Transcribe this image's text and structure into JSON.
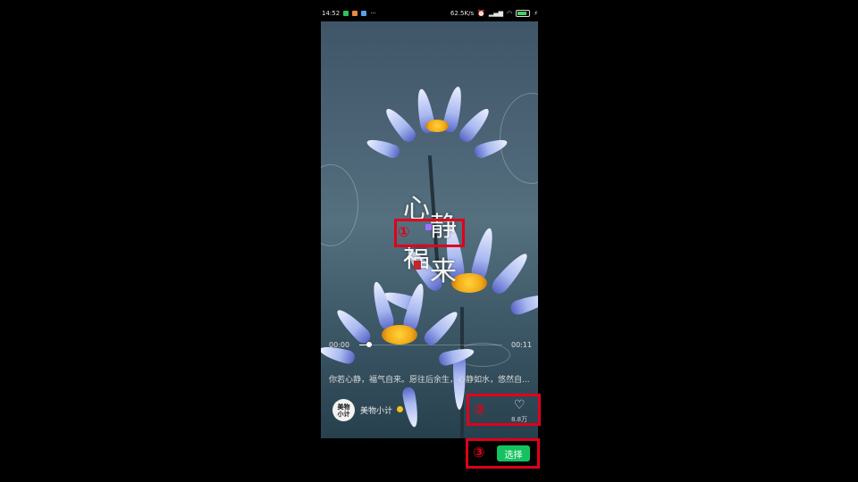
{
  "status_bar": {
    "time": "14:52",
    "more": "···",
    "network_speed": "62.5K/s",
    "battery_level": 0.8
  },
  "video": {
    "title_art": [
      "心",
      "静",
      "福",
      "来"
    ],
    "time_current": "00:00",
    "time_total": "00:11",
    "progress": 0.05,
    "caption": "你若心静，福气自来。愿往后余生，心静如水，悠然自...",
    "author_avatar": "美物\n小计",
    "author_name": "美物小计",
    "likes": "8.8万"
  },
  "annotations": {
    "marker_1": "①",
    "marker_2": "②",
    "marker_3": "③",
    "box_color": "#e0001b"
  },
  "actions": {
    "select_label": "选择"
  },
  "colors": {
    "select_button": "#14c35f",
    "badge": "#f6c21c"
  }
}
